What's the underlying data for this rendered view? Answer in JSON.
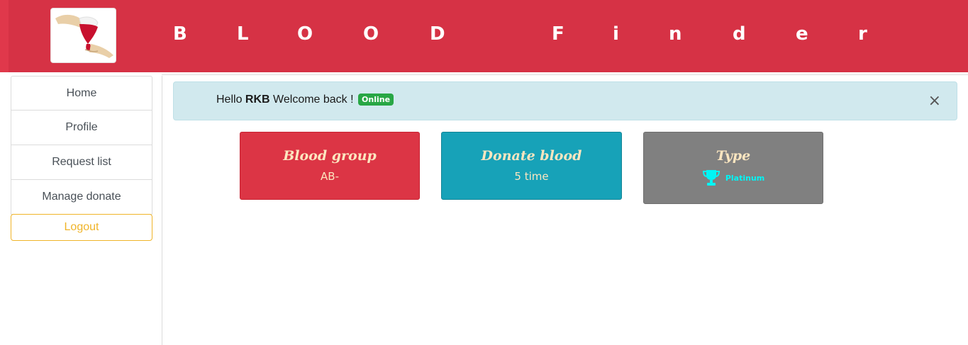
{
  "header": {
    "title_letters": [
      "B",
      "L",
      "O",
      "O",
      "D",
      "F",
      "i",
      "n",
      "d",
      "e",
      "r"
    ],
    "logo_icon": "blood-donation-hand-icon",
    "background": "#d63245"
  },
  "sidebar": {
    "items": [
      {
        "label": "Home"
      },
      {
        "label": "Profile"
      },
      {
        "label": "Request list"
      },
      {
        "label": "Manage donate"
      }
    ],
    "logout_label": "Logout",
    "logout_color": "#f0b429"
  },
  "alert": {
    "greeting": "Hello",
    "username": "RKB",
    "message": "Welcome back !",
    "status_badge": "Online",
    "close_symbol": "×"
  },
  "cards": {
    "blood_group": {
      "title": "Blood group",
      "value": "AB-",
      "color": "#dc3545"
    },
    "donate": {
      "title": "Donate blood",
      "value": "5 time",
      "color": "#17a2b8"
    },
    "type": {
      "title": "Type",
      "value": "Platinum",
      "icon": "trophy-icon",
      "color": "#808080"
    }
  }
}
